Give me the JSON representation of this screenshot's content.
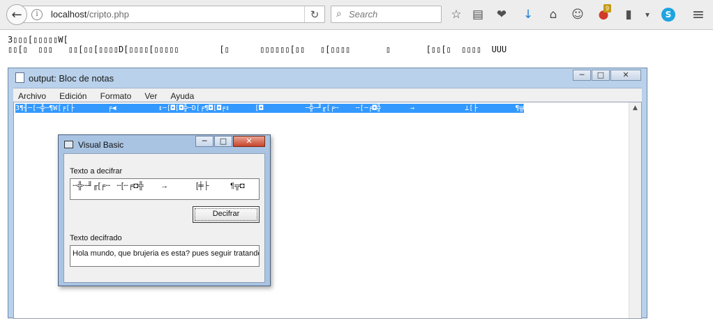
{
  "browser": {
    "url_host": "localhost",
    "url_path": "/cripto.php",
    "search_placeholder": "Search",
    "badge_count": "9",
    "glyphs": {
      "back": "←",
      "info": "i",
      "reload": "↻",
      "search": "⌕",
      "bookmark_star": "☆",
      "reading_list": "▤",
      "pocket": "❤",
      "download": "↓",
      "home": "⌂",
      "emoji": "☺",
      "colors": "●",
      "battery": "▮",
      "dropdown": "▾",
      "skype": "S",
      "menu": "≡"
    }
  },
  "page": {
    "line1": "3▯▯▯[▯▯▯▯▯W[",
    "line2": "▯▯[▯  ▯▯▯   ▯▯[▯▯[▯▯▯▯D[▯▯▯▯[▯▯▯▯▯        [▯      ▯▯▯▯▯▯[▯▯   ▯[▯▯▯▯       ▯       [▯▯[▯  ▯▯▯▯  UUU"
  },
  "notepad": {
    "title": "output: Bloc de notas",
    "menu": [
      "Archivo",
      "Edición",
      "Formato",
      "Ver",
      "Ayuda"
    ],
    "selected_text": "3¶╢╌[╌╬╌¶W[╒[├        ╒◀          ↕╌[◘[◘╬╌D[╒¶◘[◘╒↕      [◘          ╌╬╌╜╓[╒╌    ╌[╌╒◘╬       →            ⊥[├         ¶╦◘            UUU",
    "buttons": {
      "minimize": "─",
      "maximize": "□",
      "close": "✕"
    }
  },
  "vb_dialog": {
    "title": "Visual Basic",
    "label_input": "Texto a decifrar",
    "input_value": "╌╬╌╜╓[╒╌   ╌[╌╒◘╬        →             [╪├          ¶╦◘          UUU",
    "button_label": "Decifrar",
    "label_output": "Texto decifrado",
    "output_value": "Hola mundo, que brujeria es esta? pues seguir tratando p",
    "buttons": {
      "minimize": "─",
      "maximize": "□",
      "close": "✕"
    }
  }
}
